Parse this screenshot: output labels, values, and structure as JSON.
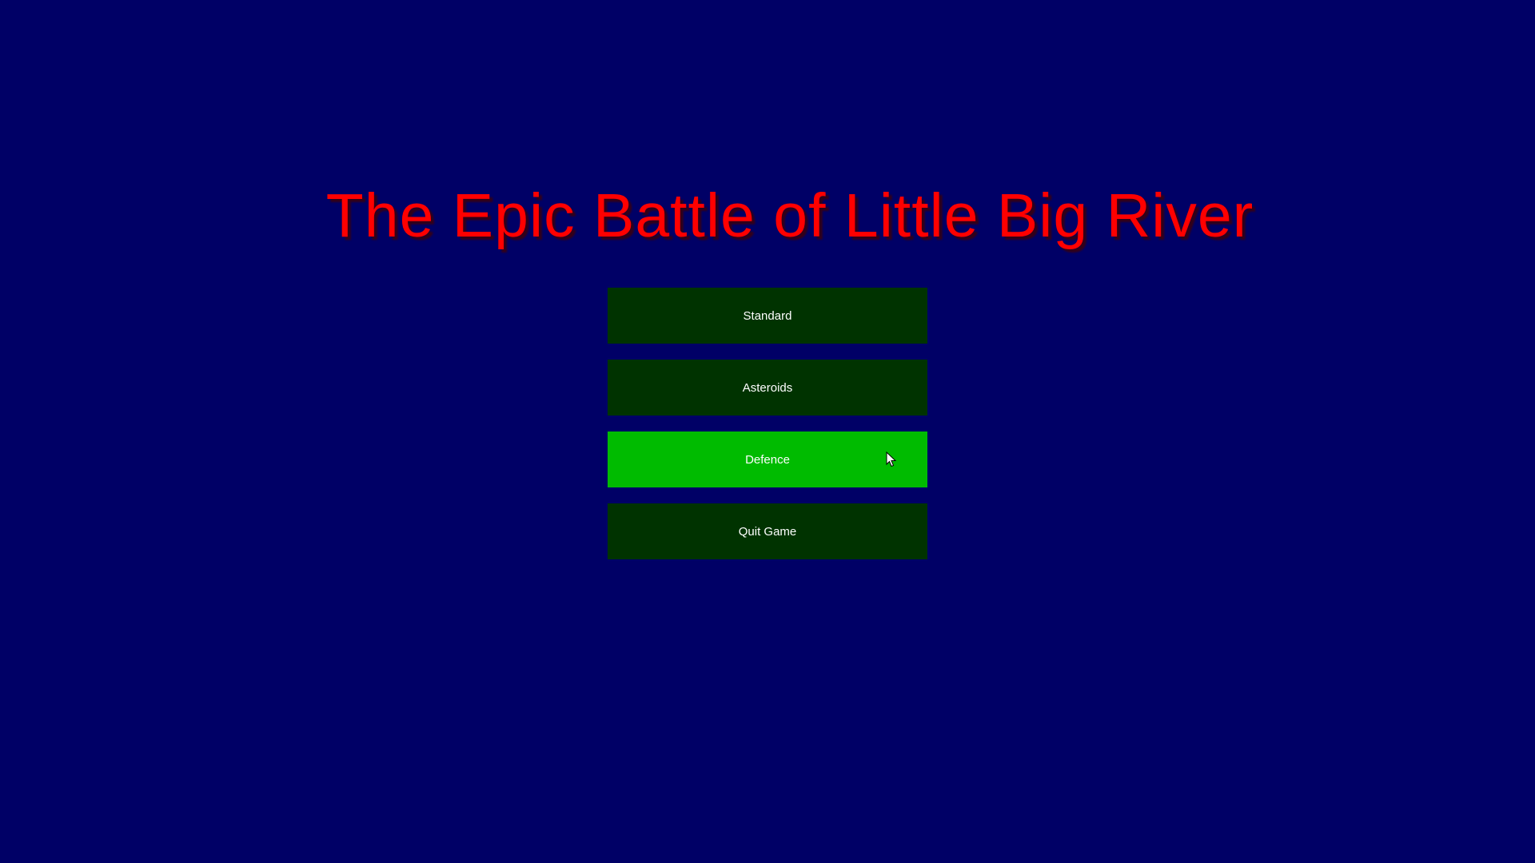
{
  "title": "The Epic Battle of Little Big River",
  "colors": {
    "background": "#000066",
    "title": "#ff0000",
    "button": "#003300",
    "button_active": "#00bb00",
    "button_text": "#ffffff"
  },
  "menu": {
    "buttons": [
      {
        "label": "Standard",
        "active": false
      },
      {
        "label": "Asteroids",
        "active": false
      },
      {
        "label": "Defence",
        "active": true
      },
      {
        "label": "Quit Game",
        "active": false
      }
    ]
  },
  "cursor_icon": "mouse-pointer-icon"
}
